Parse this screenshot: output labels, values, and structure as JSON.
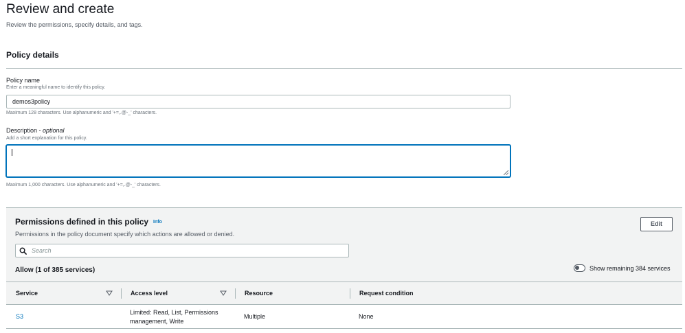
{
  "header": {
    "title": "Review and create",
    "subtitle": "Review the permissions, specify details, and tags."
  },
  "policy_details": {
    "title": "Policy details",
    "name": {
      "label": "Policy name",
      "hint": "Enter a meaningful name to identify this policy.",
      "value": "demos3policy",
      "constraint": "Maximum 128 characters. Use alphanumeric and '+=,.@-_' characters."
    },
    "description": {
      "label": "Description - ",
      "label_optional": "optional",
      "hint": "Add a short explanation for this policy.",
      "value": "",
      "constraint": "Maximum 1,000 characters. Use alphanumeric and '+=,.@-_' characters."
    }
  },
  "permissions": {
    "title": "Permissions defined in this policy",
    "info_label": "Info",
    "description": "Permissions in the policy document specify which actions are allowed or denied.",
    "edit_label": "Edit",
    "search_placeholder": "Search",
    "allow_title": "Allow (1 of 385 services)",
    "toggle_label": "Show remaining 384 services",
    "toggle_on": false,
    "columns": [
      "Service",
      "Access level",
      "Resource",
      "Request condition"
    ],
    "rows": [
      {
        "service": "S3",
        "access_level_line1": "Limited: Read, List, Permissions",
        "access_level_line2": "management, Write",
        "resource": "Multiple",
        "request_condition": "None"
      }
    ]
  },
  "colors": {
    "link": "#0073bb",
    "focus_border": "#0073bb",
    "panel_bg": "#f2f3f3"
  }
}
